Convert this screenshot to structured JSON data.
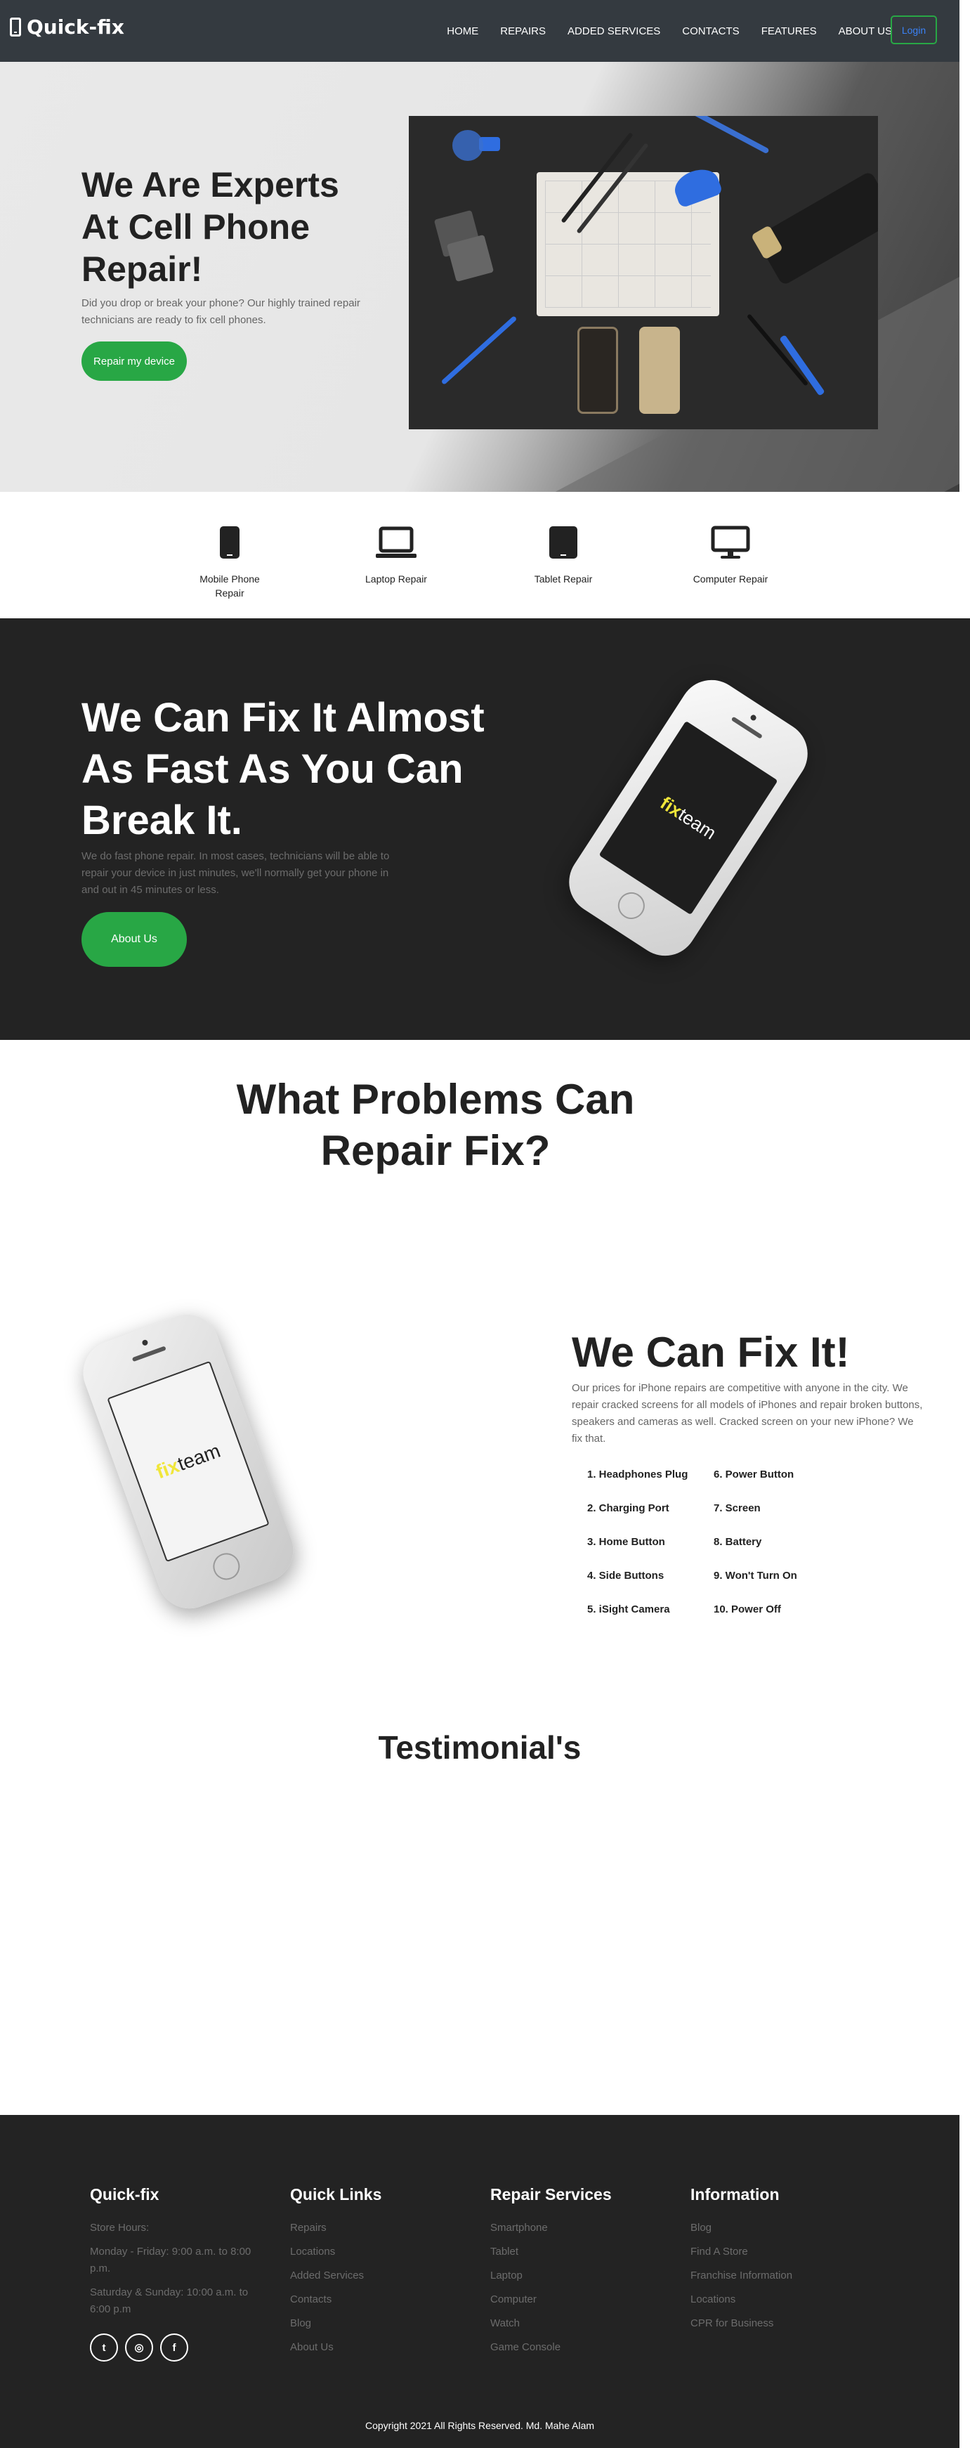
{
  "colors": {
    "navbar": "#343a40",
    "accent": "#28a745",
    "dark": "#232323",
    "login_text": "#3b82f6"
  },
  "nav": {
    "brand": "Quick-fix",
    "brand_icon": "mobile-phone-icon",
    "links": [
      "HOME",
      "REPAIRS",
      "ADDED SERVICES",
      "CONTACTS",
      "FEATURES",
      "ABOUT US"
    ],
    "login": "Login"
  },
  "hero": {
    "title": "We Are Experts At Cell Phone Repair!",
    "text": "Did you drop or break your phone? Our highly trained repair technicians are ready to fix cell phones.",
    "button": "Repair my device"
  },
  "services": [
    {
      "label": "Mobile Phone Repair",
      "icon": "mobile-phone-icon"
    },
    {
      "label": "Laptop Repair",
      "icon": "laptop-icon"
    },
    {
      "label": "Tablet Repair",
      "icon": "tablet-icon"
    },
    {
      "label": "Computer Repair",
      "icon": "desktop-icon"
    }
  ],
  "dark": {
    "title": "We Can Fix It Almost As Fast As You Can Break It.",
    "text": "We do fast phone repair. In most cases, technicians will be able to repair your device in just minutes, we'll normally get your phone in and out in 45 minutes or less.",
    "button": "About Us",
    "phone_logo_a": "fix",
    "phone_logo_b": "team"
  },
  "problems": {
    "title": "What Problems Can Repair Fix?",
    "fix_title": "We Can Fix It!",
    "fix_text": "Our prices for iPhone repairs are competitive with anyone in the city. We repair cracked screens for all models of iPhones and repair broken buttons, speakers and cameras as well. Cracked screen on your new iPhone? We fix that.",
    "items": [
      "1. Headphones Plug",
      "6. Power Button",
      "2. Charging Port",
      "7. Screen",
      "3. Home Button",
      "8. Battery",
      "4. Side Buttons",
      "9. Won't Turn On",
      "5. iSight Camera",
      "10. Power Off"
    ]
  },
  "testimonials": {
    "title": "Testimonial's"
  },
  "footer": {
    "col1": {
      "title": "Quick-fix",
      "items": [
        "Store Hours:",
        "Monday - Friday: 9:00 a.m. to 8:00 p.m.",
        "Saturday & Sunday: 10:00 a.m. to 6:00 p.m"
      ]
    },
    "col2": {
      "title": "Quick Links",
      "items": [
        "Repairs",
        "Locations",
        "Added Services",
        "Contacts",
        "Blog",
        "About Us"
      ]
    },
    "col3": {
      "title": "Repair Services",
      "items": [
        "Smartphone",
        "Tablet",
        "Laptop",
        "Computer",
        "Watch",
        "Game Console"
      ]
    },
    "col4": {
      "title": "Information",
      "items": [
        "Blog",
        "Find A Store",
        "Franchise Information",
        "Locations",
        "CPR for Business"
      ]
    },
    "socials": [
      {
        "name": "twitter-icon",
        "glyph": "t"
      },
      {
        "name": "instagram-icon",
        "glyph": "◎"
      },
      {
        "name": "facebook-icon",
        "glyph": "f"
      }
    ],
    "copyright": "Copyright 2021 All Rights Reserved. Md. Mahe Alam"
  }
}
